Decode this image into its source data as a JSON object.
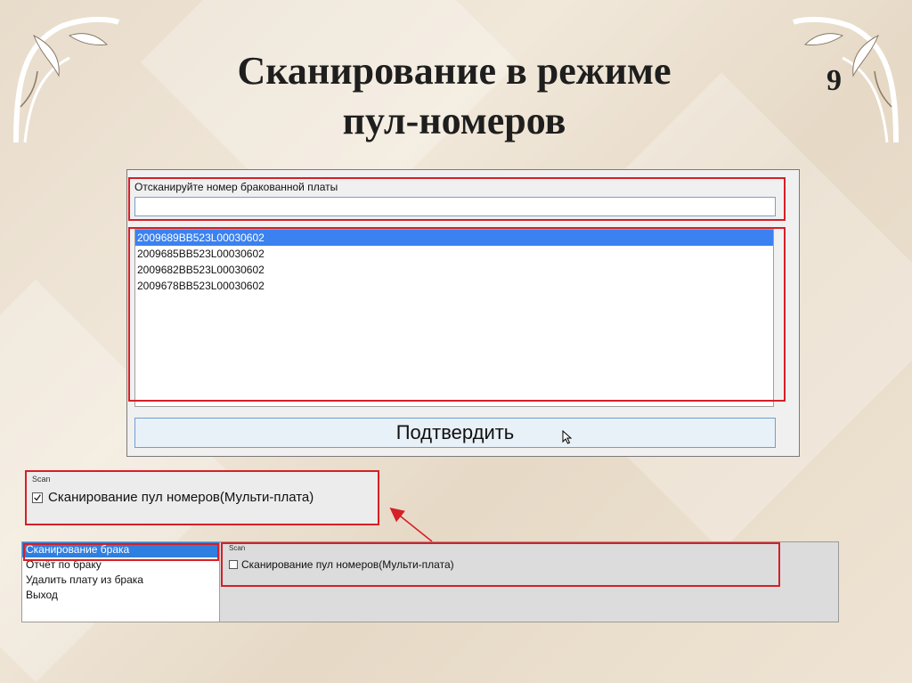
{
  "slide": {
    "title_line1": "Сканирование в режиме",
    "title_line2": "пул-номеров",
    "number": "9"
  },
  "scan_window": {
    "prompt": "Отсканируйте номер бракованной платы",
    "input_value": "",
    "serials": [
      "2009689BB523L00030602",
      "2009685BB523L00030602",
      "2009682BB523L00030602",
      "2009678BB523L00030602"
    ],
    "selected_index": 0,
    "confirm_label": "Подтвердить"
  },
  "scan_zoom": {
    "caption": "Scan",
    "checkbox_label": "Сканирование пул номеров(Мульти-плата)",
    "checked": true
  },
  "menu_window": {
    "items": [
      "Сканирование брака",
      "Отчёт по браку",
      "Удалить плату из брака",
      "Выход"
    ],
    "selected_index": 0,
    "group_caption": "Scan",
    "checkbox_label": "Сканирование пул номеров(Мульти-плата)",
    "checked": false
  },
  "colors": {
    "highlight_red": "#d42027",
    "selection_blue": "#3b82f0"
  }
}
